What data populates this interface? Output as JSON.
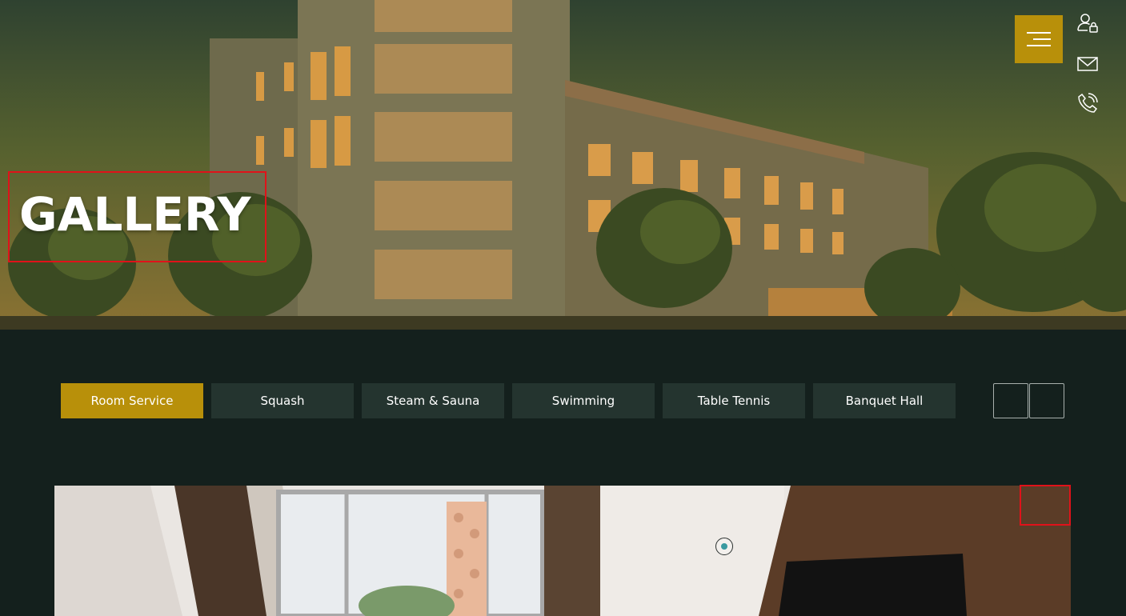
{
  "hero": {
    "title": "GALLERY"
  },
  "header": {
    "menu_icon": "hamburger-icon",
    "side_icons": [
      "user-lock-icon",
      "envelope-icon",
      "phone-call-icon"
    ]
  },
  "gallery_tabs": [
    {
      "label": "Room Service",
      "active": true
    },
    {
      "label": "Squash",
      "active": false
    },
    {
      "label": "Steam & Sauna",
      "active": false
    },
    {
      "label": "Swimming",
      "active": false
    },
    {
      "label": "Table Tennis",
      "active": false
    },
    {
      "label": "Banquet Hall",
      "active": false
    }
  ],
  "carousel": {
    "prev_icon": "arrow-left-icon",
    "next_icon": "arrow-right-icon",
    "dot_icon": "carousel-dot-icon"
  },
  "colors": {
    "accent": "#b8900a",
    "page_bg": "#14201d",
    "tab_bg": "#24342f",
    "annotation": "#e0121a"
  }
}
